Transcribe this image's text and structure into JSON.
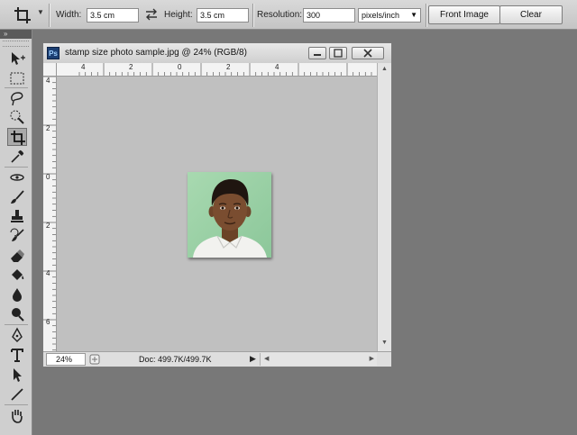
{
  "options_bar": {
    "width_label": "Width:",
    "width_value": "3.5 cm",
    "height_label": "Height:",
    "height_value": "3.5 cm",
    "resolution_label": "Resolution:",
    "resolution_value": "300",
    "units_value": "pixels/inch",
    "front_image_label": "Front Image",
    "clear_label": "Clear",
    "swap_icon": "swap-arrows-icon",
    "preset_icon": "crop-icon"
  },
  "tools": {
    "collapse_glyph": "»",
    "items": [
      "move-icon",
      "marquee-icon",
      "lasso-icon",
      "quick-selection-icon",
      "crop-icon",
      "eyedropper-icon",
      "spot-healing-icon",
      "brush-icon",
      "clone-stamp-icon",
      "history-brush-icon",
      "eraser-icon",
      "paint-bucket-icon",
      "blur-icon",
      "dodge-icon",
      "pen-icon",
      "type-icon",
      "path-selection-icon",
      "line-icon",
      "hand-icon"
    ],
    "active": "crop-icon"
  },
  "document": {
    "ps_badge": "Ps",
    "title": "stamp size photo sample.jpg @ 24% (RGB/8)",
    "zoom": "24%",
    "doc_info": "Doc: 499.7K/499.7K",
    "h_ruler_labels": [
      "4",
      "2",
      "0",
      "2",
      "4"
    ],
    "v_ruler_labels": [
      "4",
      "2",
      "0",
      "2",
      "4",
      "6"
    ]
  },
  "colors": {
    "workspace": "#787878",
    "canvas": "#c0c0c0",
    "photo_background": "#9fd3a8"
  }
}
